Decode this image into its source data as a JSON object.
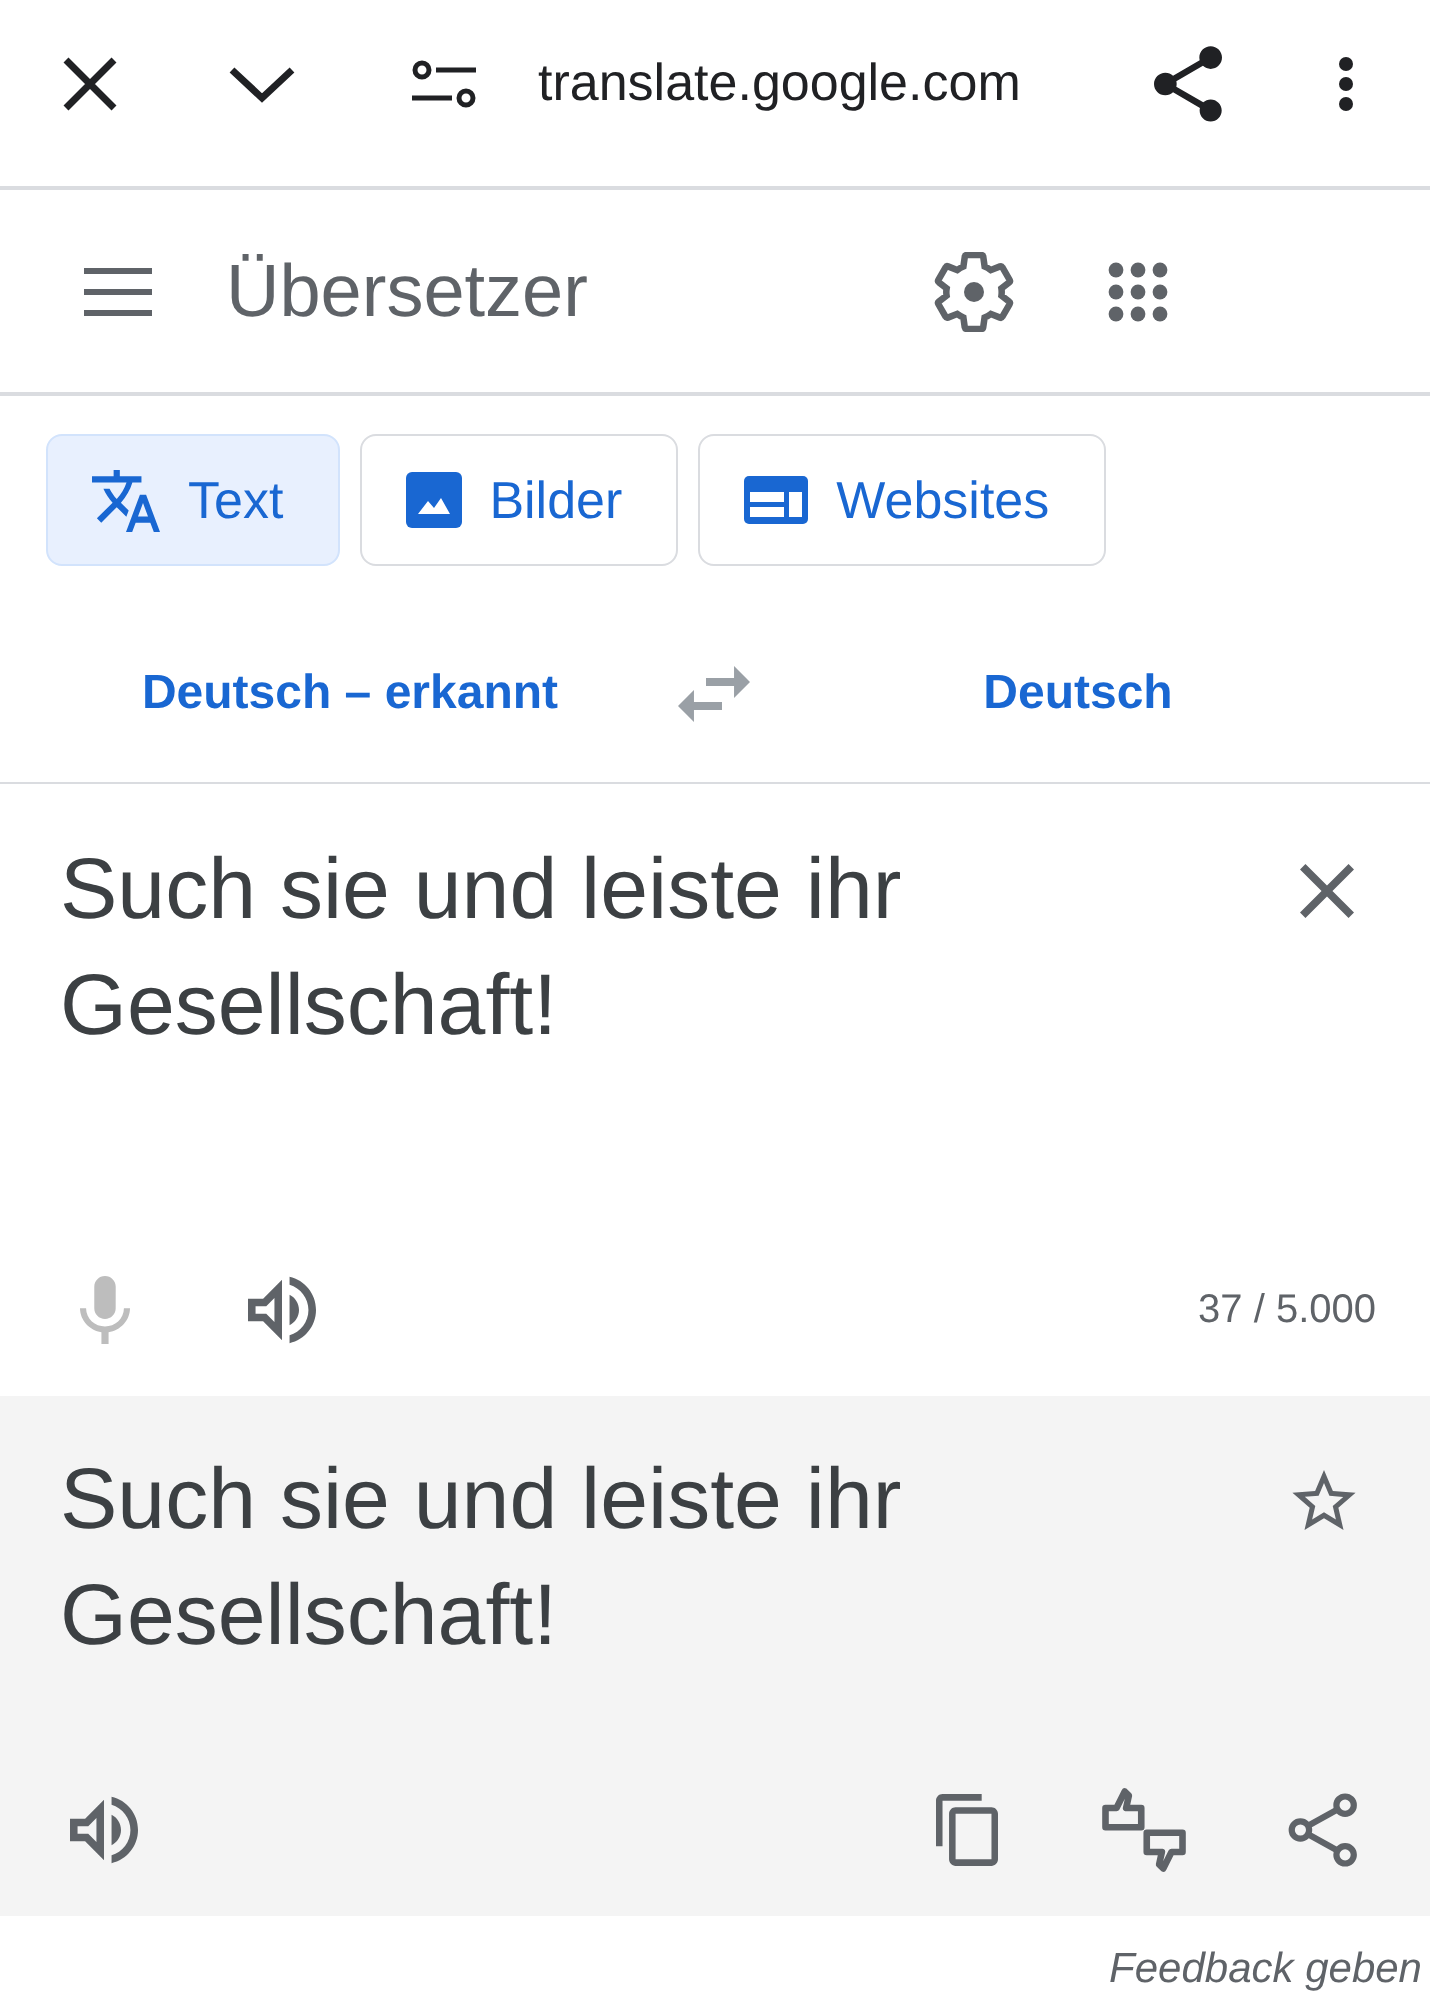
{
  "browser_bar": {
    "url": "translate.google.com"
  },
  "app_header": {
    "title": "Übersetzer"
  },
  "tabs": [
    {
      "label": "Text",
      "selected": true
    },
    {
      "label": "Bilder",
      "selected": false
    },
    {
      "label": "Websites",
      "selected": false
    }
  ],
  "languages": {
    "source": "Deutsch – erkannt",
    "target": "Deutsch"
  },
  "source": {
    "text": "Such sie und leiste ihr Gesellschaft!",
    "mic_disabled": true,
    "char_count": "37 / 5.000"
  },
  "translation": {
    "text": "Such sie und leiste ihr Gesellschaft!",
    "starred": false
  },
  "feedback_link": "Feedback geben"
}
